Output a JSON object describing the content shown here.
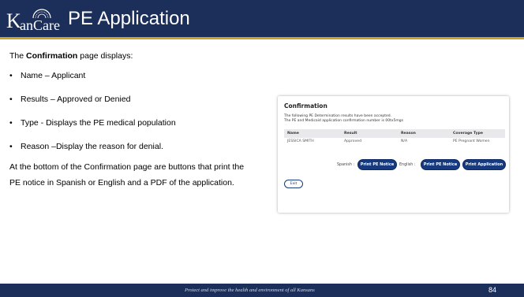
{
  "header": {
    "logo_k": "K",
    "logo_rest": "anCare",
    "title": "PE Application"
  },
  "content": {
    "intro_prefix": "The ",
    "intro_bold": "Confirmation",
    "intro_suffix": " page displays:",
    "bullet_glyph": "•",
    "bullets": [
      "Name – Applicant",
      "Results – Approved or Denied",
      "Type - Displays the PE medical population",
      "Reason –Display the reason for denial."
    ],
    "paragraph": "At the bottom of the Confirmation page are buttons that print the PE notice in Spanish or English and a PDF of the application."
  },
  "confirmation": {
    "title": "Confirmation",
    "message_line1": "The following PE Determination results have been accepted.",
    "message_line2": "The PE and Medicaid application confirmation number is 00tx5mgs",
    "columns": [
      "Name",
      "Result",
      "Reason",
      "Coverage Type"
    ],
    "row": [
      "JESSICA SMITH",
      "Approved",
      "N/A",
      "PE Pregnant Women"
    ],
    "spanish_label": "Spanish :",
    "english_label": "English :",
    "print_notice_spanish": "Print PE Notice",
    "print_notice_english": "Print PE Notice",
    "print_application": "Print Application",
    "exit": "Exit"
  },
  "footer": {
    "tagline": "Protect and improve the health and environment of all Kansans",
    "page_number": "84"
  },
  "colors": {
    "header_bg": "#1c2f5a",
    "accent_rule": "#c9a227",
    "button_bg": "#163a7d"
  }
}
